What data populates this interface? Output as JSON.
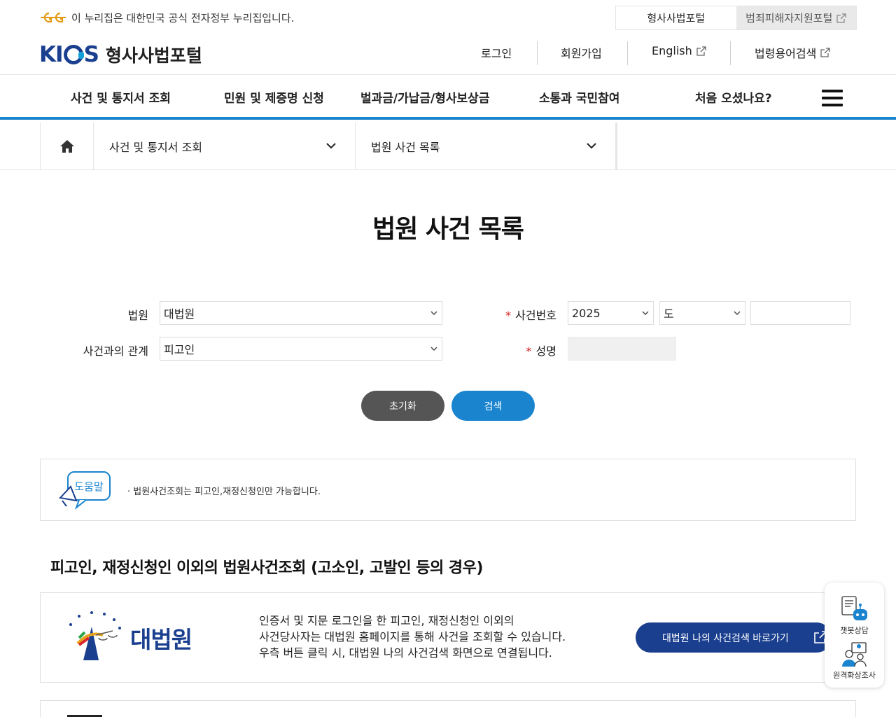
{
  "gov": {
    "notice": "이 누리집은 대한민국 공식 전자정부 누리집입니다.",
    "tabs": [
      "형사사법포털",
      "범죄피해자지원포털"
    ]
  },
  "header": {
    "logo_mark": "KICS",
    "logo_text": "형사사법포털",
    "util": {
      "login": "로그인",
      "signup": "회원가입",
      "english": "English",
      "glossary": "법령용어검색"
    }
  },
  "gnb": {
    "items": [
      "사건 및 통지서 조회",
      "민원 및 제증명 신청",
      "벌과금/가납금/형사보상금",
      "소통과 국민참여",
      "처음 오셨나요?"
    ]
  },
  "breadcrumb": {
    "level1": "사건 및 통지서 조회",
    "level2": "법원 사건 목록"
  },
  "page_title": "법원 사건 목록",
  "form": {
    "court_label": "법원",
    "court_value": "대법원",
    "relation_label": "사건과의 관계",
    "relation_value": "피고인",
    "case_no_label": "사건번호",
    "case_year": "2025",
    "case_type": "도",
    "case_no_value": "",
    "name_label": "성명",
    "name_value": "",
    "reset_label": "초기화",
    "search_label": "검색"
  },
  "help": {
    "badge": "도움말",
    "text": "· 법원사건조회는 피고인,재정신청인만 가능합니다."
  },
  "other": {
    "title": "피고인, 재정신청인 이외의 법원사건조회 (고소인, 고발인 등의 경우)",
    "court_name": "대법원",
    "lines": [
      "인증서 및 지문 로그인을 한 피고인, 재정신청인 이외의",
      "사건당사자는 대법원 홈페이지를 통해 사건을 조회할 수 있습니다.",
      "우측 버튼 클릭 시, 대법원 나의 사건검색 화면으로 연결됩니다."
    ],
    "button": "대법원 나의 사건검색 바로가기"
  },
  "float": {
    "chatbot": "챗봇상담",
    "video": "원격화상조사"
  },
  "colors": {
    "primary": "#1a84cf",
    "navy": "#1a3f8f",
    "required": "#d42020"
  }
}
